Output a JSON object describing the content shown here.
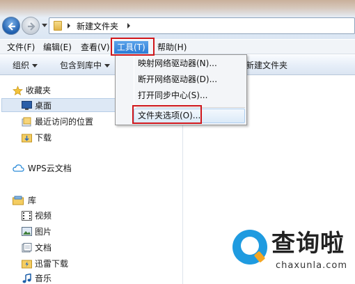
{
  "address_bar": {
    "path": "新建文件夹"
  },
  "menu_bar": {
    "items": [
      "文件(F)",
      "编辑(E)",
      "查看(V)",
      "工具(T)",
      "帮助(H)"
    ]
  },
  "toolbar": {
    "organize": "组织",
    "include_in_library": "包含到库中",
    "new_folder": "新建文件夹"
  },
  "tools_menu": {
    "items": [
      "映射网络驱动器(N)...",
      "断开网络驱动器(D)...",
      "打开同步中心(S)...",
      "文件夹选项(O)..."
    ]
  },
  "nav_pane": {
    "favorites": "收藏夹",
    "desktop": "桌面",
    "recent_places": "最近访问的位置",
    "downloads": "下载",
    "wps_cloud": "WPS云文档",
    "libraries": "库",
    "videos": "视频",
    "pictures": "图片",
    "documents": "文档",
    "thunder_downloads": "迅雷下载",
    "music": "音乐"
  },
  "watermark": {
    "title": "查询啦",
    "url": "chaxunla.com"
  }
}
